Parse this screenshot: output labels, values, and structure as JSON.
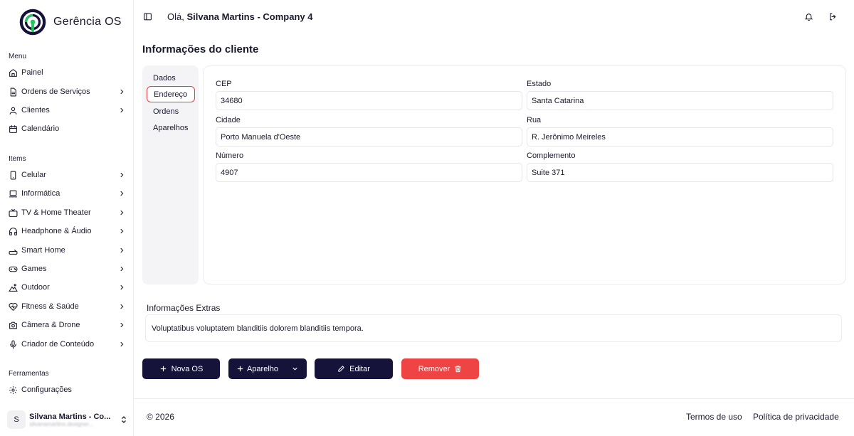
{
  "brand": {
    "name": "Gerência OS"
  },
  "sidebar": {
    "menu_label": "Menu",
    "menu_items": [
      {
        "label": "Painel",
        "icon": "home-icon"
      },
      {
        "label": "Ordens de Serviços",
        "icon": "file-icon"
      },
      {
        "label": "Clientes",
        "icon": "user-icon"
      },
      {
        "label": "Calendário",
        "icon": "calendar-icon"
      }
    ],
    "items_label": "Items",
    "items": [
      {
        "label": "Celular",
        "icon": "smartphone-icon"
      },
      {
        "label": "Informática",
        "icon": "laptop-icon"
      },
      {
        "label": "TV & Home Theater",
        "icon": "tv-icon"
      },
      {
        "label": "Headphone & Áudio",
        "icon": "headphone-icon"
      },
      {
        "label": "Smart Home",
        "icon": "router-icon"
      },
      {
        "label": "Games",
        "icon": "gamepad-icon"
      },
      {
        "label": "Outdoor",
        "icon": "outdoor-icon"
      },
      {
        "label": "Fitness & Saúde",
        "icon": "heart-pulse-icon"
      },
      {
        "label": "Câmera & Drone",
        "icon": "camera-icon"
      },
      {
        "label": "Criador de Conteúdo",
        "icon": "microphone-icon"
      }
    ],
    "tools_label": "Ferramentas",
    "tools": [
      {
        "label": "Configurações",
        "icon": "gear-icon"
      }
    ],
    "user": {
      "initial": "S",
      "name": "Silvana Martins - Co...",
      "email": "silvanamartins.designer..."
    }
  },
  "header": {
    "greeting_prefix": "Olá, ",
    "greeting_name": "Silvana Martins - Company 4"
  },
  "page": {
    "title": "Informações do cliente",
    "tabs": [
      {
        "label": "Dados",
        "active": false
      },
      {
        "label": "Endereço",
        "active": true
      },
      {
        "label": "Ordens",
        "active": false
      },
      {
        "label": "Aparelhos",
        "active": false
      }
    ],
    "fields": {
      "cep": {
        "label": "CEP",
        "value": "34680"
      },
      "estado": {
        "label": "Estado",
        "value": "Santa Catarina"
      },
      "cidade": {
        "label": "Cidade",
        "value": "Porto Manuela d'Oeste"
      },
      "rua": {
        "label": "Rua",
        "value": "R. Jerônimo Meireles"
      },
      "numero": {
        "label": "Número",
        "value": "4907"
      },
      "complemento": {
        "label": "Complemento",
        "value": "Suite 371"
      }
    },
    "extras": {
      "label": "Informações Extras",
      "text": "Voluptatibus voluptatem blanditiis dolorem blanditiis tempora."
    },
    "actions": {
      "nova_os": "Nova OS",
      "aparelho": "Aparelho",
      "editar": "Editar",
      "remover": "Remover"
    }
  },
  "footer": {
    "copyright": "© 2026",
    "terms": "Termos de uso",
    "privacy": "Política de privacidade"
  },
  "colors": {
    "primary_dark": "#16133a",
    "danger": "#ef4444",
    "brand_green": "#22c55e"
  }
}
